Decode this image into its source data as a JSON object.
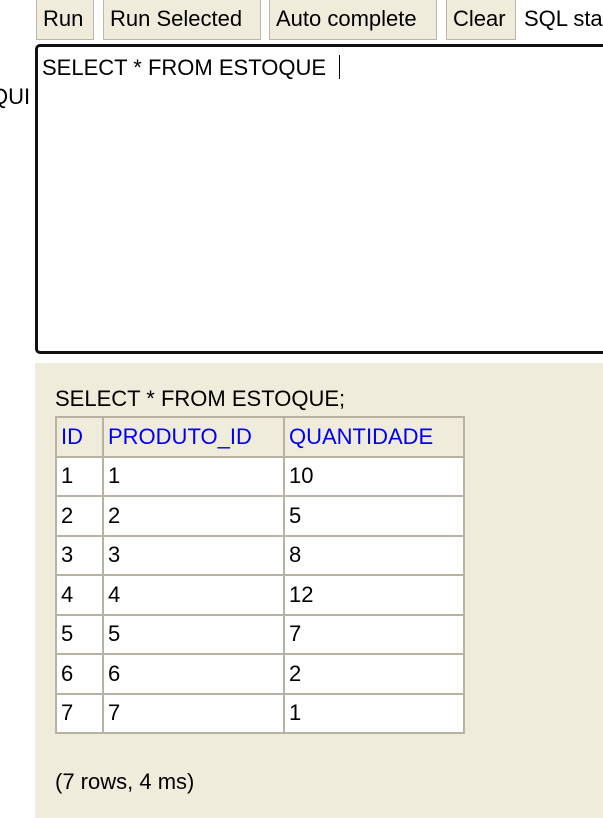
{
  "toolbar": {
    "run_label": "Run",
    "run_selected_label": "Run Selected",
    "auto_complete_label": "Auto complete",
    "clear_label": "Clear",
    "sql_statement_label": "SQL sta"
  },
  "side_label": "QUI",
  "editor": {
    "text": "SELECT * FROM ESTOQUE "
  },
  "results": {
    "query": "SELECT * FROM ESTOQUE;",
    "columns": [
      "ID",
      "PRODUTO_ID",
      "QUANTIDADE"
    ],
    "rows": [
      [
        "1",
        "1",
        "10"
      ],
      [
        "2",
        "2",
        "5"
      ],
      [
        "3",
        "3",
        "8"
      ],
      [
        "4",
        "4",
        "12"
      ],
      [
        "5",
        "5",
        "7"
      ],
      [
        "6",
        "6",
        "2"
      ],
      [
        "7",
        "7",
        "1"
      ]
    ],
    "summary": "(7 rows, 4 ms)"
  },
  "colors": {
    "panel_bg": "#f0ecdc",
    "header_link": "#0000ee",
    "grid_border": "#b7b2a2"
  }
}
